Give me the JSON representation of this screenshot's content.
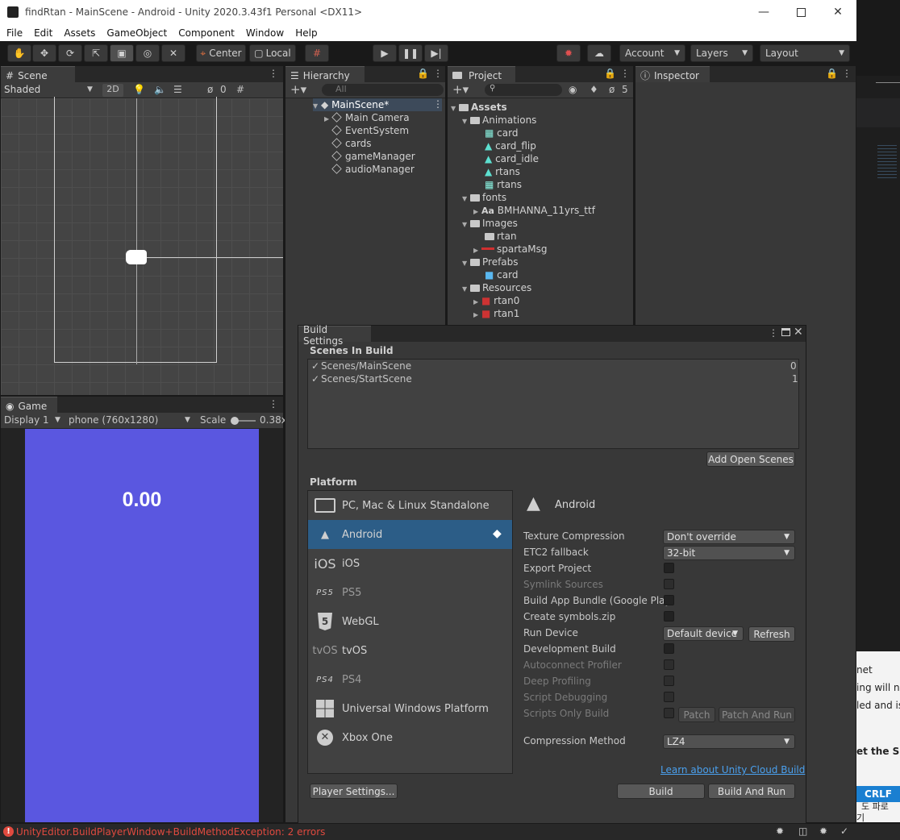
{
  "window": {
    "title": "findRtan - MainScene - Android - Unity 2020.3.43f1 Personal <DX11>"
  },
  "menu": [
    "File",
    "Edit",
    "Assets",
    "GameObject",
    "Component",
    "Window",
    "Help"
  ],
  "toolbar": {
    "pivot_label": "Center",
    "space_label": "Local",
    "account_label": "Account",
    "layers_label": "Layers",
    "layout_label": "Layout"
  },
  "scene": {
    "tab": "Scene",
    "shading": "Shaded",
    "mode_2d": "2D",
    "hidden_count": "0"
  },
  "game": {
    "tab": "Game",
    "display": "Display 1",
    "resolution": "phone (760x1280)",
    "scale_label": "Scale",
    "scale_value": "0.38x",
    "score_text": "0.00",
    "background": "#5a57e0"
  },
  "hierarchy": {
    "tab": "Hierarchy",
    "search_placeholder": "All",
    "scene_name": "MainScene*",
    "items": [
      "Main Camera",
      "EventSystem",
      "cards",
      "gameManager",
      "audioManager"
    ]
  },
  "project": {
    "tab": "Project",
    "hidden_count": "5",
    "root": "Assets",
    "tree": {
      "animations": "Animations",
      "anim_items": [
        "card",
        "card_flip",
        "card_idle",
        "rtans",
        "rtans"
      ],
      "fonts": "fonts",
      "font_item": "BMHANNA_11yrs_ttf",
      "font_prefix": "Aa",
      "images": "Images",
      "image_items": [
        "rtan",
        "spartaMsg"
      ],
      "prefabs": "Prefabs",
      "prefab_item": "card",
      "resources": "Resources",
      "resource_items": [
        "rtan0",
        "rtan1"
      ]
    }
  },
  "inspector": {
    "tab": "Inspector"
  },
  "build_settings": {
    "title": "Build Settings",
    "scenes_header": "Scenes In Build",
    "scenes": [
      {
        "name": "Scenes/MainScene",
        "index": "0"
      },
      {
        "name": "Scenes/StartScene",
        "index": "1"
      }
    ],
    "add_open_scenes": "Add Open Scenes",
    "platform_header": "Platform",
    "platforms": [
      {
        "label": "PC, Mac & Linux Standalone",
        "icon": "monitor-icon"
      },
      {
        "label": "Android",
        "icon": "android-icon",
        "selected": true
      },
      {
        "label": "iOS",
        "icon": "ios-icon",
        "icon_text": "iOS"
      },
      {
        "label": "PS5",
        "icon": "ps5-icon",
        "icon_text": "PS5"
      },
      {
        "label": "WebGL",
        "icon": "html5-icon"
      },
      {
        "label": "tvOS",
        "icon": "tvos-icon",
        "icon_text": "tvOS"
      },
      {
        "label": "PS4",
        "icon": "ps4-icon",
        "icon_text": "PS4"
      },
      {
        "label": "Universal Windows Platform",
        "icon": "windows-icon"
      },
      {
        "label": "Xbox One",
        "icon": "xbox-icon"
      }
    ],
    "selected_platform": "Android",
    "settings": {
      "texture_compression": {
        "label": "Texture Compression",
        "value": "Don't override"
      },
      "etc2_fallback": {
        "label": "ETC2 fallback",
        "value": "32-bit"
      },
      "export_project": "Export Project",
      "symlink_sources": "Symlink Sources",
      "build_app_bundle": "Build App Bundle (Google Play",
      "create_symbols": "Create symbols.zip",
      "run_device": {
        "label": "Run Device",
        "value": "Default device",
        "refresh": "Refresh"
      },
      "development_build": "Development Build",
      "autoconnect_profiler": "Autoconnect Profiler",
      "deep_profiling": "Deep Profiling",
      "script_debugging": "Script Debugging",
      "scripts_only_build": "Scripts Only Build",
      "patch": "Patch",
      "patch_and_run": "Patch And Run",
      "compression_method": {
        "label": "Compression Method",
        "value": "LZ4"
      }
    },
    "cloud_link": "Learn about Unity Cloud Build",
    "player_settings": "Player Settings...",
    "build": "Build",
    "build_and_run": "Build And Run"
  },
  "status": {
    "error_text": "UnityEditor.BuildPlayerWindow+BuildMethodException: 2 errors",
    "error_color": "#e04a3f"
  },
  "background_window": {
    "lines": [
      "net",
      "ing will n",
      "led and is",
      "et the SDK"
    ],
    "crlf": "CRLF",
    "korean_1": "도 파로",
    "korean_2": "기"
  }
}
